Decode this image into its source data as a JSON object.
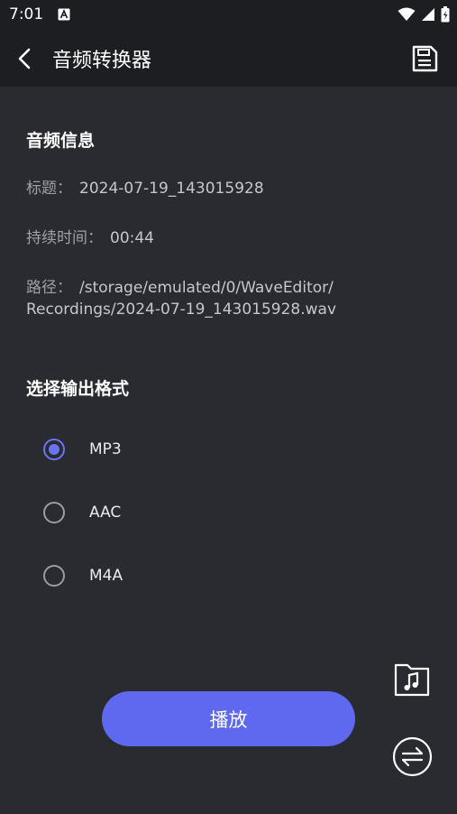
{
  "status": {
    "time": "7:01"
  },
  "header": {
    "title": "音频转换器"
  },
  "audio_info": {
    "section_title": "音频信息",
    "title_label": "标题：",
    "title_value": "2024-07-19_143015928",
    "duration_label": "持续时间：",
    "duration_value": "00:44",
    "path_label": "路径：",
    "path_value_line1": "/storage/emulated/0/WaveEditor/",
    "path_value_line2": "Recordings/2024-07-19_143015928.wav"
  },
  "format": {
    "section_title": "选择输出格式",
    "options": [
      {
        "label": "MP3",
        "checked": true
      },
      {
        "label": "AAC",
        "checked": false
      },
      {
        "label": "M4A",
        "checked": false
      }
    ]
  },
  "actions": {
    "play_label": "播放"
  },
  "colors": {
    "accent": "#5e69ef",
    "background": "#2a2b30",
    "bar": "#1d1e22"
  }
}
